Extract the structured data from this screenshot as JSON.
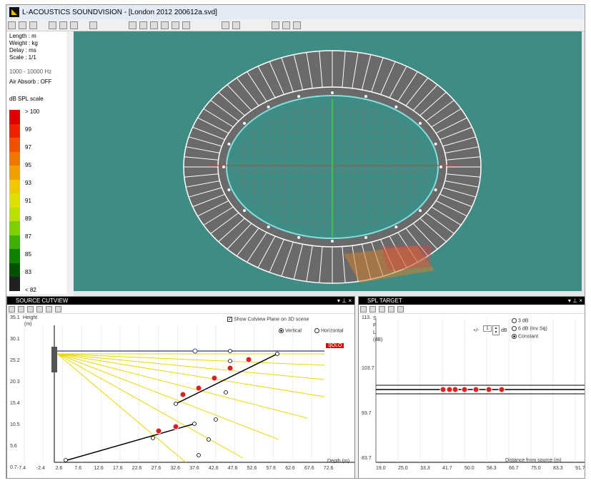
{
  "app": {
    "title": "L-ACOUSTICS SOUNDVISION - [London 2012 200612a.svd]"
  },
  "left_panel": {
    "length": "Length : m",
    "weight": "Weight : kg",
    "delay": "Delay : ms",
    "scale": "Scale : 1/1",
    "freq": "1000 - 10000 Hz",
    "air": "Air Absorb : OFF",
    "spl_title": "dB SPL scale",
    "scale_labels": [
      "> 100",
      "99",
      "97",
      "95",
      "93",
      "91",
      "89",
      "87",
      "85",
      "83",
      "< 82"
    ],
    "scale_colors": [
      "#e00000",
      "#f02000",
      "#f05000",
      "#f07800",
      "#f0a000",
      "#f0c800",
      "#e0e000",
      "#b8e000",
      "#80d000",
      "#40b000",
      "#108000",
      "#005000",
      "#202020"
    ]
  },
  "cutview": {
    "header": "SOURCE CUTVIEW",
    "checkbox_label": "Show Cutview Plane on 3D scene",
    "radio_vertical": "Vertical",
    "radio_horizontal": "Horizontal",
    "y_axis_label": "Height",
    "y_axis_unit": "(m)",
    "x_axis_label": "Depth (m)",
    "solo": "SOLO",
    "y_ticks": [
      "35.1",
      "30.1",
      "25.2",
      "20.3",
      "15.4",
      "10.5",
      "5.6",
      "0.7"
    ],
    "x_ticks": [
      "-7.4",
      "-2.4",
      "2.6",
      "7.6",
      "12.6",
      "17.6",
      "22.6",
      "27.6",
      "32.6",
      "37.6",
      "42.6",
      "47.6",
      "52.6",
      "57.6",
      "62.6",
      "67.6",
      "72.6"
    ]
  },
  "spltarget": {
    "header": "SPL TARGET",
    "y_label_chars": [
      "S",
      "P",
      "L"
    ],
    "y_unit": "(dB)",
    "y_ticks": [
      "113.",
      "103.7",
      "93.7",
      "83.7"
    ],
    "x_ticks": [
      "19.0",
      "25.0",
      "33.3",
      "41.7",
      "50.0",
      "58.3",
      "66.7",
      "75.0",
      "83.3",
      "91.7"
    ],
    "x_label": "Distance from source (m)",
    "tolerance_prefix": "+/-",
    "tolerance_value": "1",
    "tolerance_unit": "dB",
    "opt_3db": "3 dB",
    "opt_6db": "6 dB (Inv Sq)",
    "opt_const": "Constant"
  }
}
